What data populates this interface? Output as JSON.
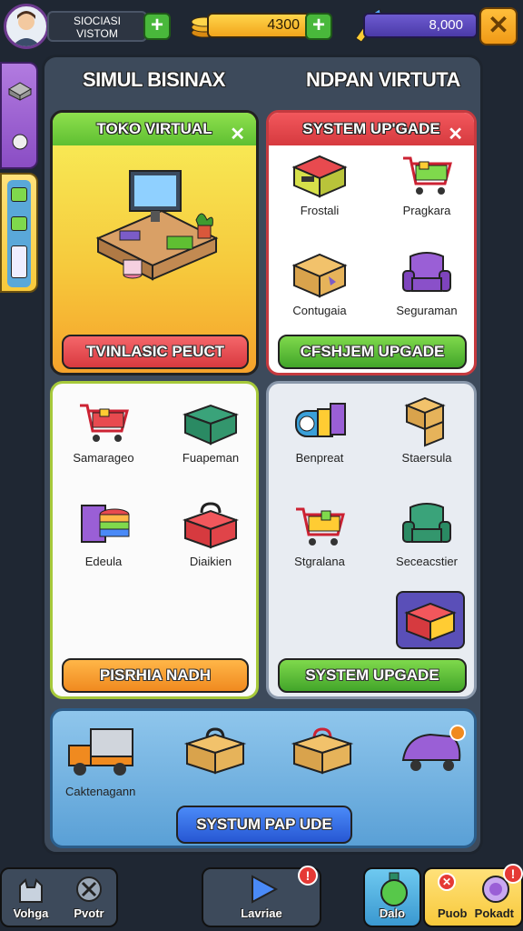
{
  "hud": {
    "profile_line1": "SIOCIASI",
    "profile_line2": "VISTOM",
    "plus": "+",
    "coins": "4300",
    "gems": "8,000",
    "close": "✕"
  },
  "panel": {
    "heading_left": "SIMUL BISINAX",
    "heading_right": "NDPAN VIRTUTA"
  },
  "cards": {
    "toko": {
      "title": "TOKO VIRTUAL",
      "close": "✕",
      "button": "TVINLASIC PEUCT"
    },
    "system": {
      "title": "SYSTEM UP'GADE",
      "close": "✕",
      "items": [
        "Frostali",
        "Pragkara",
        "Contugaia",
        "Seguraman"
      ],
      "button": "CFSHJEM UPGADE"
    },
    "mid_left": {
      "items": [
        "Samarageo",
        "Fuapeman",
        "Edeula",
        "Diaikien"
      ],
      "button": "PISRHIA NADH"
    },
    "mid_right": {
      "items": [
        "Benpreat",
        "Staersula",
        "Stgralana",
        "Seceacstier"
      ],
      "button": "SYSTEM UPGADE"
    },
    "bottom": {
      "item_label": "Caktenagann",
      "button": "SYSTUM PAP UDE"
    }
  },
  "nav": {
    "left1": "Vohga",
    "left2": "Pvotr",
    "center": "Lavriae",
    "badge": "!",
    "right1": "Dalo",
    "right2a": "Puob",
    "right2b": "Pokadt"
  },
  "colors": {
    "panel_bg": "#3d4a5b",
    "green_card": "#7fd94c",
    "red_card": "#e84a4f",
    "accent_orange": "#f09a17"
  }
}
